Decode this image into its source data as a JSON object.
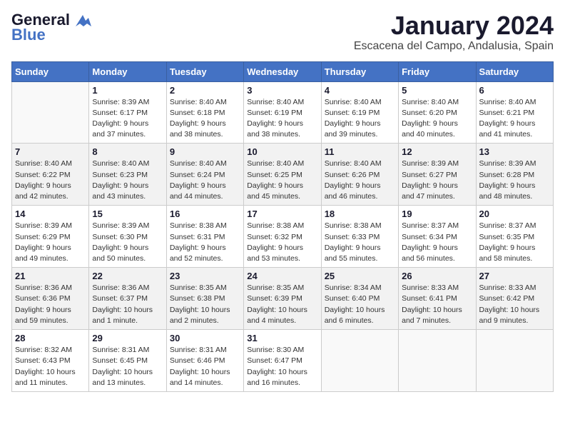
{
  "logo": {
    "line1": "General",
    "line2": "Blue"
  },
  "title": "January 2024",
  "subtitle": "Escacena del Campo, Andalusia, Spain",
  "days_header": [
    "Sunday",
    "Monday",
    "Tuesday",
    "Wednesday",
    "Thursday",
    "Friday",
    "Saturday"
  ],
  "weeks": [
    [
      {
        "day": "",
        "info": ""
      },
      {
        "day": "1",
        "info": "Sunrise: 8:39 AM\nSunset: 6:17 PM\nDaylight: 9 hours\nand 37 minutes."
      },
      {
        "day": "2",
        "info": "Sunrise: 8:40 AM\nSunset: 6:18 PM\nDaylight: 9 hours\nand 38 minutes."
      },
      {
        "day": "3",
        "info": "Sunrise: 8:40 AM\nSunset: 6:19 PM\nDaylight: 9 hours\nand 38 minutes."
      },
      {
        "day": "4",
        "info": "Sunrise: 8:40 AM\nSunset: 6:19 PM\nDaylight: 9 hours\nand 39 minutes."
      },
      {
        "day": "5",
        "info": "Sunrise: 8:40 AM\nSunset: 6:20 PM\nDaylight: 9 hours\nand 40 minutes."
      },
      {
        "day": "6",
        "info": "Sunrise: 8:40 AM\nSunset: 6:21 PM\nDaylight: 9 hours\nand 41 minutes."
      }
    ],
    [
      {
        "day": "7",
        "info": "Sunrise: 8:40 AM\nSunset: 6:22 PM\nDaylight: 9 hours\nand 42 minutes."
      },
      {
        "day": "8",
        "info": "Sunrise: 8:40 AM\nSunset: 6:23 PM\nDaylight: 9 hours\nand 43 minutes."
      },
      {
        "day": "9",
        "info": "Sunrise: 8:40 AM\nSunset: 6:24 PM\nDaylight: 9 hours\nand 44 minutes."
      },
      {
        "day": "10",
        "info": "Sunrise: 8:40 AM\nSunset: 6:25 PM\nDaylight: 9 hours\nand 45 minutes."
      },
      {
        "day": "11",
        "info": "Sunrise: 8:40 AM\nSunset: 6:26 PM\nDaylight: 9 hours\nand 46 minutes."
      },
      {
        "day": "12",
        "info": "Sunrise: 8:39 AM\nSunset: 6:27 PM\nDaylight: 9 hours\nand 47 minutes."
      },
      {
        "day": "13",
        "info": "Sunrise: 8:39 AM\nSunset: 6:28 PM\nDaylight: 9 hours\nand 48 minutes."
      }
    ],
    [
      {
        "day": "14",
        "info": "Sunrise: 8:39 AM\nSunset: 6:29 PM\nDaylight: 9 hours\nand 49 minutes."
      },
      {
        "day": "15",
        "info": "Sunrise: 8:39 AM\nSunset: 6:30 PM\nDaylight: 9 hours\nand 50 minutes."
      },
      {
        "day": "16",
        "info": "Sunrise: 8:38 AM\nSunset: 6:31 PM\nDaylight: 9 hours\nand 52 minutes."
      },
      {
        "day": "17",
        "info": "Sunrise: 8:38 AM\nSunset: 6:32 PM\nDaylight: 9 hours\nand 53 minutes."
      },
      {
        "day": "18",
        "info": "Sunrise: 8:38 AM\nSunset: 6:33 PM\nDaylight: 9 hours\nand 55 minutes."
      },
      {
        "day": "19",
        "info": "Sunrise: 8:37 AM\nSunset: 6:34 PM\nDaylight: 9 hours\nand 56 minutes."
      },
      {
        "day": "20",
        "info": "Sunrise: 8:37 AM\nSunset: 6:35 PM\nDaylight: 9 hours\nand 58 minutes."
      }
    ],
    [
      {
        "day": "21",
        "info": "Sunrise: 8:36 AM\nSunset: 6:36 PM\nDaylight: 9 hours\nand 59 minutes."
      },
      {
        "day": "22",
        "info": "Sunrise: 8:36 AM\nSunset: 6:37 PM\nDaylight: 10 hours\nand 1 minute."
      },
      {
        "day": "23",
        "info": "Sunrise: 8:35 AM\nSunset: 6:38 PM\nDaylight: 10 hours\nand 2 minutes."
      },
      {
        "day": "24",
        "info": "Sunrise: 8:35 AM\nSunset: 6:39 PM\nDaylight: 10 hours\nand 4 minutes."
      },
      {
        "day": "25",
        "info": "Sunrise: 8:34 AM\nSunset: 6:40 PM\nDaylight: 10 hours\nand 6 minutes."
      },
      {
        "day": "26",
        "info": "Sunrise: 8:33 AM\nSunset: 6:41 PM\nDaylight: 10 hours\nand 7 minutes."
      },
      {
        "day": "27",
        "info": "Sunrise: 8:33 AM\nSunset: 6:42 PM\nDaylight: 10 hours\nand 9 minutes."
      }
    ],
    [
      {
        "day": "28",
        "info": "Sunrise: 8:32 AM\nSunset: 6:43 PM\nDaylight: 10 hours\nand 11 minutes."
      },
      {
        "day": "29",
        "info": "Sunrise: 8:31 AM\nSunset: 6:45 PM\nDaylight: 10 hours\nand 13 minutes."
      },
      {
        "day": "30",
        "info": "Sunrise: 8:31 AM\nSunset: 6:46 PM\nDaylight: 10 hours\nand 14 minutes."
      },
      {
        "day": "31",
        "info": "Sunrise: 8:30 AM\nSunset: 6:47 PM\nDaylight: 10 hours\nand 16 minutes."
      },
      {
        "day": "",
        "info": ""
      },
      {
        "day": "",
        "info": ""
      },
      {
        "day": "",
        "info": ""
      }
    ]
  ]
}
